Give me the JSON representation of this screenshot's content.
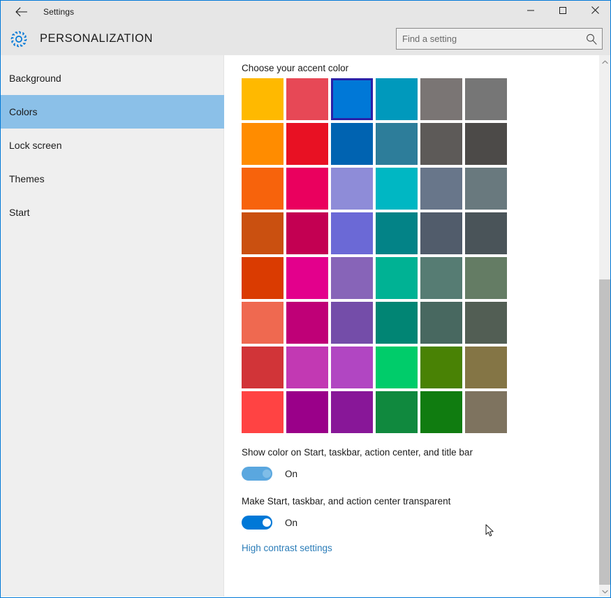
{
  "window": {
    "app_title": "Settings",
    "page_title": "PERSONALIZATION",
    "accent_color": "#0078d7",
    "back_icon": "back-arrow-icon",
    "gear_icon": "gear-icon",
    "minimize_label": "Minimize",
    "maximize_label": "Maximize",
    "close_label": "Close"
  },
  "search": {
    "placeholder": "Find a setting",
    "value": "",
    "icon": "search-icon"
  },
  "sidebar": {
    "items": [
      {
        "label": "Background",
        "selected": false
      },
      {
        "label": "Colors",
        "selected": true
      },
      {
        "label": "Lock screen",
        "selected": false
      },
      {
        "label": "Themes",
        "selected": false
      },
      {
        "label": "Start",
        "selected": false
      }
    ],
    "selected_index": 1,
    "selection_background": "#8bc0e8",
    "background": "#efefef"
  },
  "main": {
    "accent_heading": "Choose your accent color",
    "selected_swatch_index": 2,
    "selection_border_color": "#2a20a8",
    "accent_colors": [
      "#ffb900",
      "#e74856",
      "#0078d7",
      "#0099bc",
      "#7a7574",
      "#767676",
      "#ff8c00",
      "#e81123",
      "#0063b1",
      "#2d7d9a",
      "#5d5a58",
      "#4c4a48",
      "#f7630c",
      "#ea005e",
      "#8e8cd8",
      "#00b7c3",
      "#68768a",
      "#69797e",
      "#ca5010",
      "#c30052",
      "#6b69d6",
      "#038387",
      "#515c6b",
      "#4a5459",
      "#da3b01",
      "#e3008c",
      "#8764b8",
      "#00b294",
      "#567c73",
      "#647c64",
      "#ef6950",
      "#bf0077",
      "#744da9",
      "#018574",
      "#486860",
      "#525e54",
      "#d13438",
      "#c239b3",
      "#b146c2",
      "#00cc6a",
      "#498205",
      "#847545",
      "#ff4343",
      "#9a0089",
      "#881798",
      "#10893e",
      "#107c10",
      "#7e735f"
    ],
    "settings": [
      {
        "label": "Show color on Start, taskbar, action center, and title bar",
        "state": "On",
        "enabled": true,
        "hovered": true
      },
      {
        "label": "Make Start, taskbar, and action center transparent",
        "state": "On",
        "enabled": true,
        "hovered": false
      }
    ],
    "high_contrast_link": "High contrast settings",
    "link_color": "#2a7cb8"
  },
  "scrollbar": {
    "up_arrow_icon": "chevron-up-icon",
    "down_arrow_icon": "chevron-down-icon",
    "thumb_color": "#c1c1c1",
    "track_color": "#f0f0f0"
  }
}
